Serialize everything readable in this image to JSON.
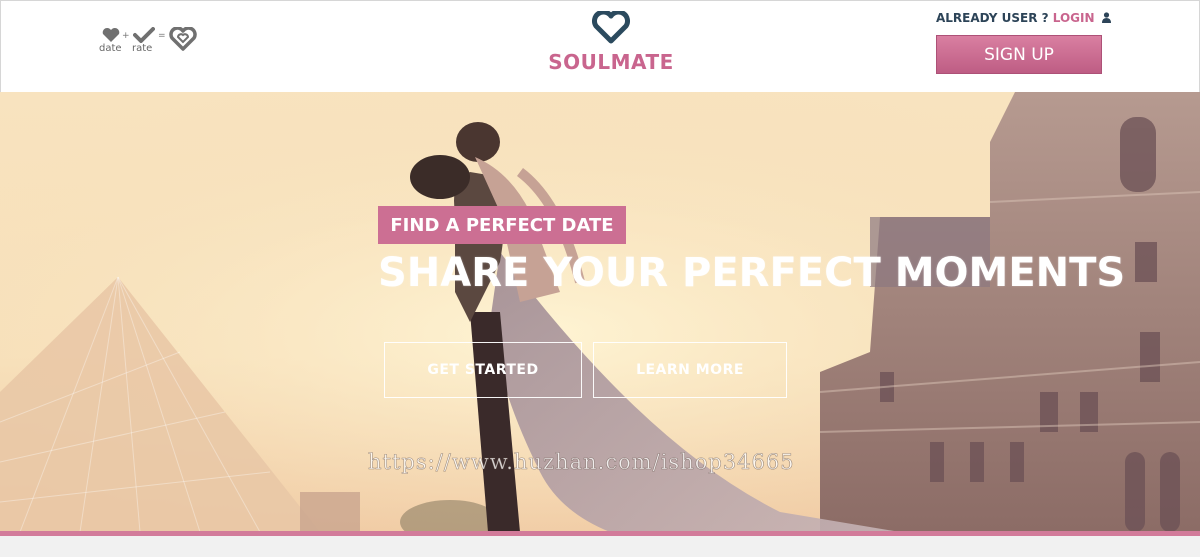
{
  "header": {
    "formula": {
      "date_label": "date",
      "plus": "+",
      "rate_label": "rate",
      "equals": "=",
      "icons": [
        "heart-icon",
        "check-icon",
        "double-heart-icon"
      ]
    },
    "logo": {
      "text": "SOULMATE",
      "icon": "heart-outline-icon",
      "icon_color": "#2b4a5e",
      "text_color": "#c9658e"
    },
    "account": {
      "prompt": "ALREADY USER ?",
      "login_label": "LOGIN",
      "login_icon": "user-icon"
    },
    "signup_label": "SIGN UP"
  },
  "hero": {
    "tagline": "FIND A PERFECT DATE",
    "headline": "SHARE YOUR PERFECT MOMENTS",
    "buttons": {
      "get_started": "GET STARTED",
      "learn_more": "LEARN MORE"
    },
    "watermark": "https://www.huzhan.com/ishop34665"
  },
  "colors": {
    "accent": "#cc6f93",
    "dark": "#2d4458",
    "bar": "#d27b9a"
  }
}
